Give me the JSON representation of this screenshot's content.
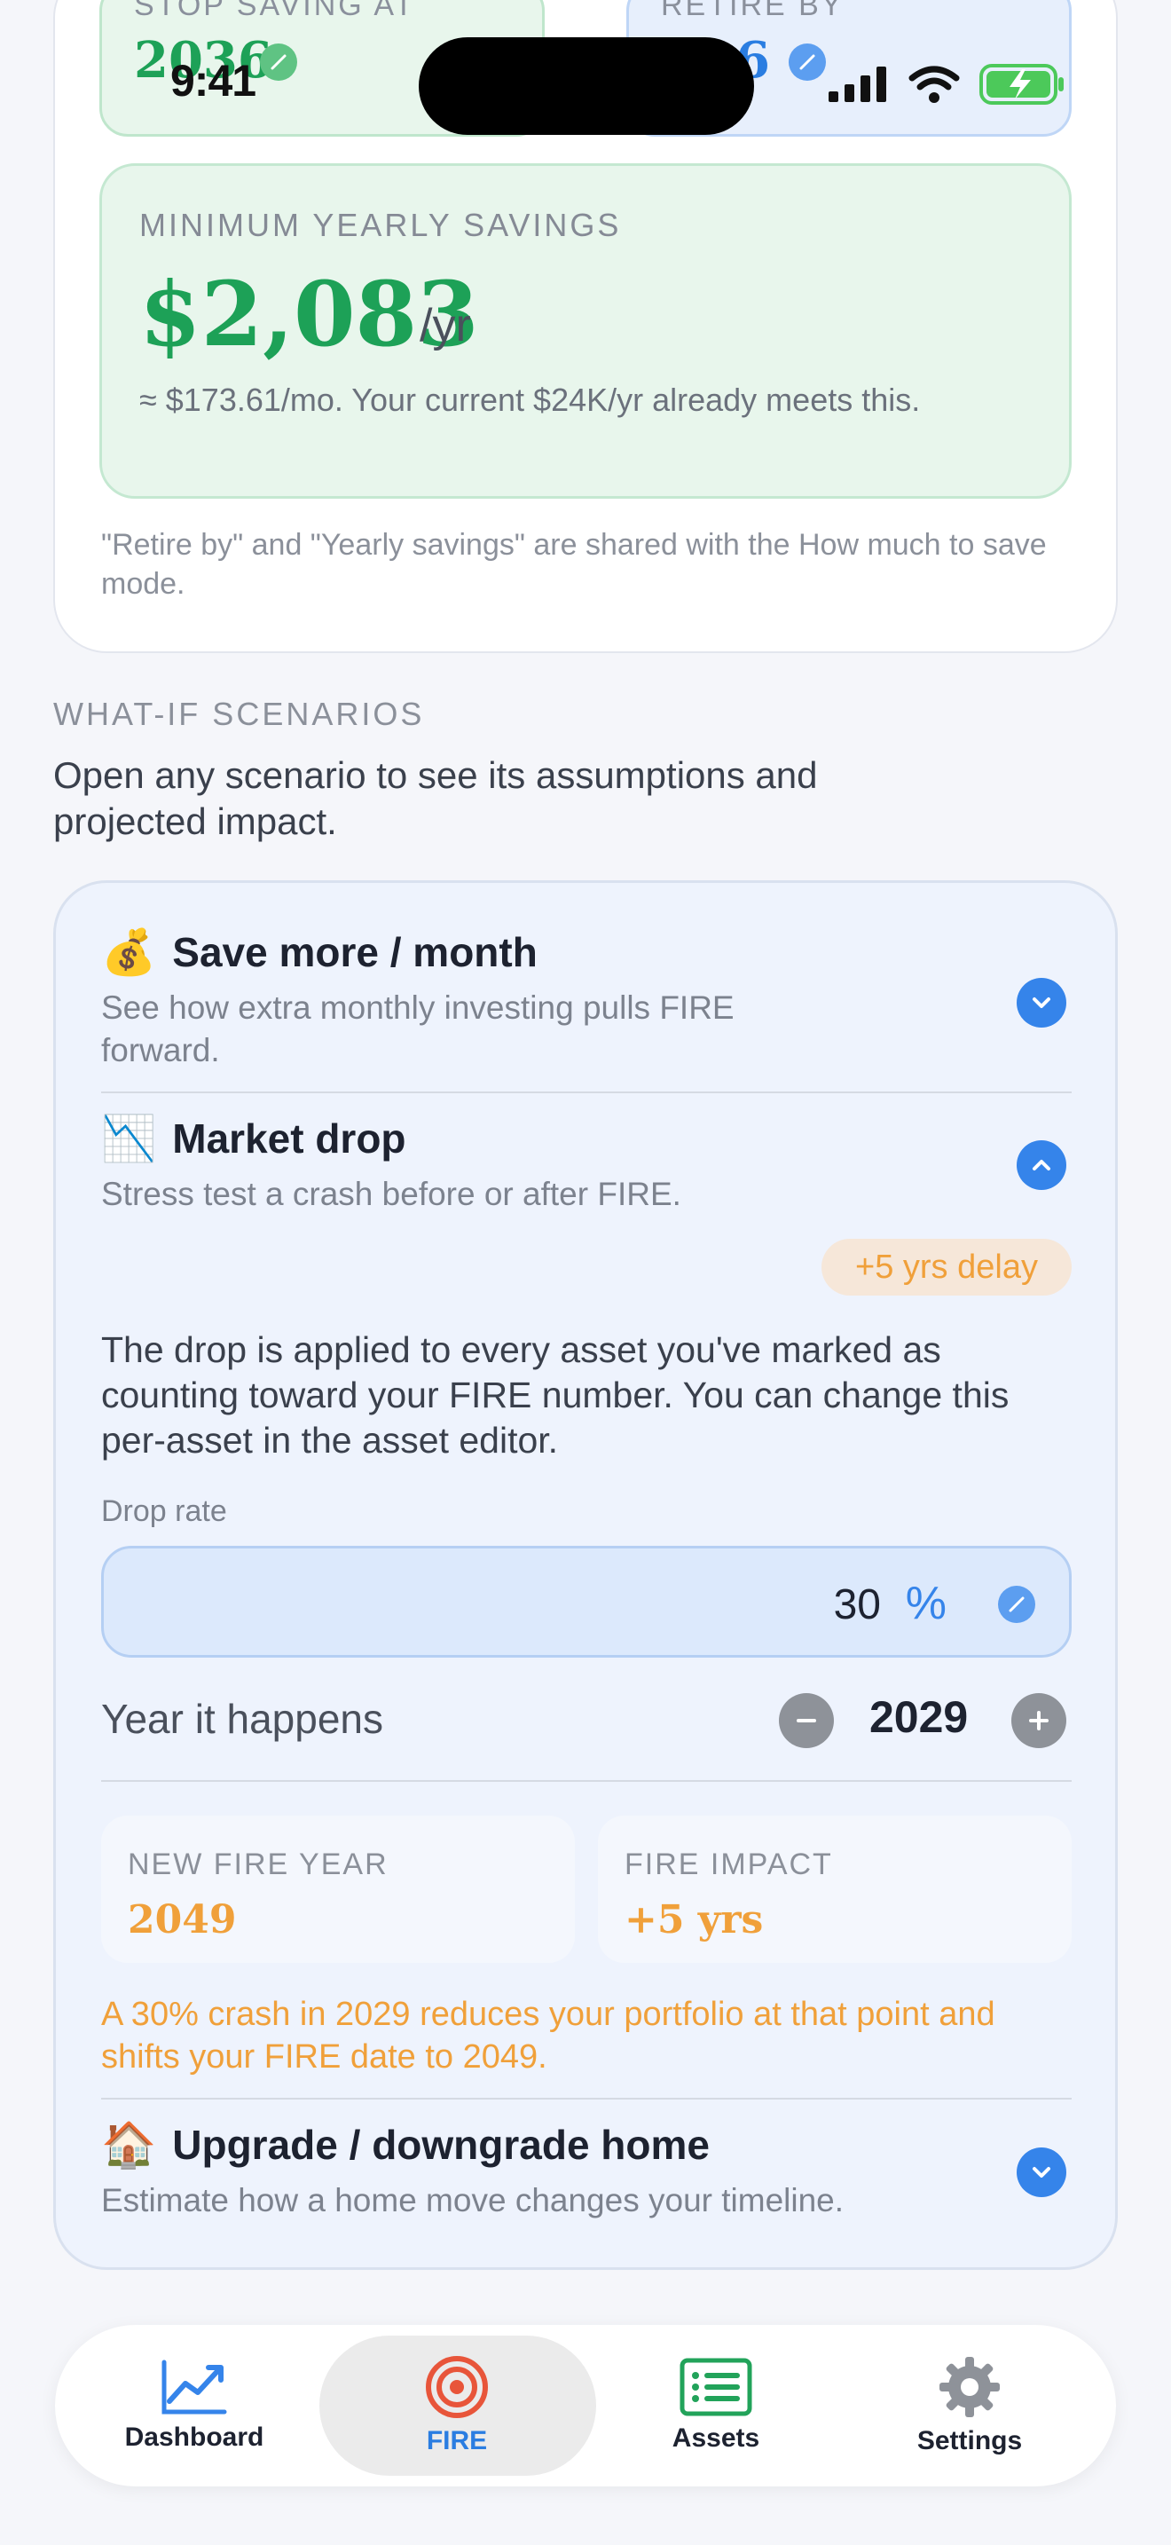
{
  "status_bar": {
    "time": "9:41"
  },
  "top_card": {
    "stop_saving": {
      "label": "STOP SAVING AT",
      "value": "2036"
    },
    "retire_by": {
      "label": "RETIRE BY",
      "value": "6"
    },
    "min_yearly_savings": {
      "label": "MINIMUM YEARLY SAVINGS",
      "amount": "$2,083",
      "unit": "/yr",
      "note": "≈ $173.61/mo. Your current $24K/yr already meets this."
    },
    "footnote": "\"Retire by\" and \"Yearly savings\" are shared with the How much to save mode."
  },
  "what_if": {
    "title": "WHAT-IF SCENARIOS",
    "subtitle": "Open any scenario to see its assumptions and projected impact.",
    "scenarios": [
      {
        "emoji": "💰",
        "title": "Save more / month",
        "subtitle": "See how extra monthly investing pulls FIRE forward.",
        "expanded": false
      },
      {
        "emoji": "📉",
        "title": "Market drop",
        "subtitle": "Stress test a crash before or after FIRE.",
        "expanded": true,
        "badge": "+5 yrs delay",
        "description": "The drop is applied to every asset you've marked as counting toward your FIRE number. You can change this per-asset in the asset editor.",
        "drop_rate_label": "Drop rate",
        "drop_rate_value": "30",
        "drop_rate_unit": "%",
        "year_label": "Year it happens",
        "year_value": "2029",
        "new_fire_year_label": "NEW FIRE YEAR",
        "new_fire_year_value": "2049",
        "fire_impact_label": "FIRE IMPACT",
        "fire_impact_value": "+5 yrs",
        "impact_note": "A 30% crash in 2029 reduces your portfolio at that point and shifts your FIRE date to 2049."
      },
      {
        "emoji": "🏠",
        "title": "Upgrade / downgrade home",
        "subtitle": "Estimate how a home move changes your timeline.",
        "expanded": false
      }
    ]
  },
  "tabbar": {
    "items": [
      {
        "label": "Dashboard",
        "icon": "chart-line-icon"
      },
      {
        "label": "FIRE",
        "icon": "target-icon",
        "active": true
      },
      {
        "label": "Assets",
        "icon": "list-icon"
      },
      {
        "label": "Settings",
        "icon": "gear-icon"
      }
    ]
  },
  "colors": {
    "green": "#1da157",
    "blue": "#3584ea",
    "orange": "#f0a03a",
    "fire_red": "#e8553a",
    "assets_green": "#22a35a"
  }
}
